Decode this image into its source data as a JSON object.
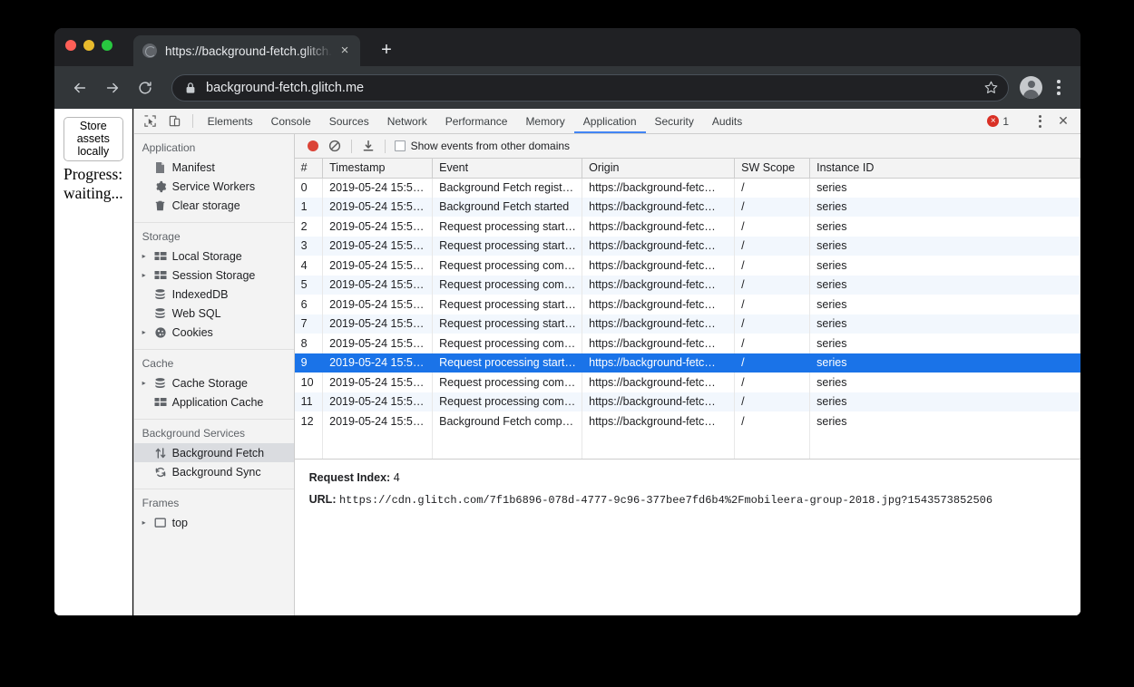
{
  "browser": {
    "tab": {
      "title": "https://background-fetch.glitch.me",
      "favicon": "globe-icon",
      "close": "×"
    },
    "new_tab": "+",
    "nav": {
      "back": "back-arrow-icon",
      "forward": "forward-arrow-icon",
      "reload": "reload-icon"
    },
    "omnibox": {
      "url": "background-fetch.glitch.me",
      "lock": "lock-icon",
      "star": "star-icon"
    },
    "profile": "avatar-icon",
    "menu": "kebab-menu-icon"
  },
  "page": {
    "store_assets_button": "Store assets locally",
    "progress": "Progress: waiting..."
  },
  "devtools": {
    "tabs": [
      {
        "label": "Elements",
        "selected": false
      },
      {
        "label": "Console",
        "selected": false
      },
      {
        "label": "Sources",
        "selected": false
      },
      {
        "label": "Network",
        "selected": false
      },
      {
        "label": "Performance",
        "selected": false
      },
      {
        "label": "Memory",
        "selected": false
      },
      {
        "label": "Application",
        "selected": true
      },
      {
        "label": "Security",
        "selected": false
      },
      {
        "label": "Audits",
        "selected": false
      }
    ],
    "error_count": "1",
    "close_label": "✕",
    "accent_color": "#4285f4",
    "selection_color": "#1a73e8",
    "error_color": "#d93025",
    "record_color": "#db4437",
    "sidebar": [
      {
        "header": "Application",
        "items": [
          {
            "label": "Manifest",
            "icon": "document-icon",
            "arrow": false,
            "selected": false
          },
          {
            "label": "Service Workers",
            "icon": "gear-icon",
            "arrow": false,
            "selected": false
          },
          {
            "label": "Clear storage",
            "icon": "trash-icon",
            "arrow": false,
            "selected": false
          }
        ]
      },
      {
        "header": "Storage",
        "items": [
          {
            "label": "Local Storage",
            "icon": "table-icon",
            "arrow": true,
            "selected": false
          },
          {
            "label": "Session Storage",
            "icon": "table-icon",
            "arrow": true,
            "selected": false
          },
          {
            "label": "IndexedDB",
            "icon": "database-icon",
            "arrow": false,
            "selected": false
          },
          {
            "label": "Web SQL",
            "icon": "database-icon",
            "arrow": false,
            "selected": false
          },
          {
            "label": "Cookies",
            "icon": "cookie-icon",
            "arrow": true,
            "selected": false
          }
        ]
      },
      {
        "header": "Cache",
        "items": [
          {
            "label": "Cache Storage",
            "icon": "database-icon",
            "arrow": true,
            "selected": false
          },
          {
            "label": "Application Cache",
            "icon": "table-icon",
            "arrow": false,
            "selected": false
          }
        ]
      },
      {
        "header": "Background Services",
        "items": [
          {
            "label": "Background Fetch",
            "icon": "updown-arrows-icon",
            "arrow": false,
            "selected": true
          },
          {
            "label": "Background Sync",
            "icon": "refresh-icon",
            "arrow": false,
            "selected": false
          }
        ]
      },
      {
        "header": "Frames",
        "items": [
          {
            "label": "top",
            "icon": "frame-icon",
            "arrow": true,
            "selected": false
          }
        ]
      }
    ],
    "toolbar": {
      "record": "record-button",
      "clear": "clear-button",
      "save": "save-button",
      "checkbox_checked": false,
      "checkbox_label": "Show events from other domains"
    },
    "table": {
      "columns": [
        "#",
        "Timestamp",
        "Event",
        "Origin",
        "SW Scope",
        "Instance ID"
      ],
      "rows": [
        {
          "idx": "0",
          "ts": "2019-05-24 15:5…",
          "event": "Background Fetch regist…",
          "origin": "https://background-fetc…",
          "sw": "/",
          "instance": "series",
          "selected": false
        },
        {
          "idx": "1",
          "ts": "2019-05-24 15:5…",
          "event": "Background Fetch started",
          "origin": "https://background-fetc…",
          "sw": "/",
          "instance": "series",
          "selected": false
        },
        {
          "idx": "2",
          "ts": "2019-05-24 15:5…",
          "event": "Request processing start…",
          "origin": "https://background-fetc…",
          "sw": "/",
          "instance": "series",
          "selected": false
        },
        {
          "idx": "3",
          "ts": "2019-05-24 15:5…",
          "event": "Request processing start…",
          "origin": "https://background-fetc…",
          "sw": "/",
          "instance": "series",
          "selected": false
        },
        {
          "idx": "4",
          "ts": "2019-05-24 15:5…",
          "event": "Request processing com…",
          "origin": "https://background-fetc…",
          "sw": "/",
          "instance": "series",
          "selected": false
        },
        {
          "idx": "5",
          "ts": "2019-05-24 15:5…",
          "event": "Request processing com…",
          "origin": "https://background-fetc…",
          "sw": "/",
          "instance": "series",
          "selected": false
        },
        {
          "idx": "6",
          "ts": "2019-05-24 15:5…",
          "event": "Request processing start…",
          "origin": "https://background-fetc…",
          "sw": "/",
          "instance": "series",
          "selected": false
        },
        {
          "idx": "7",
          "ts": "2019-05-24 15:5…",
          "event": "Request processing start…",
          "origin": "https://background-fetc…",
          "sw": "/",
          "instance": "series",
          "selected": false
        },
        {
          "idx": "8",
          "ts": "2019-05-24 15:5…",
          "event": "Request processing com…",
          "origin": "https://background-fetc…",
          "sw": "/",
          "instance": "series",
          "selected": false
        },
        {
          "idx": "9",
          "ts": "2019-05-24 15:5…",
          "event": "Request processing start…",
          "origin": "https://background-fetc…",
          "sw": "/",
          "instance": "series",
          "selected": true
        },
        {
          "idx": "10",
          "ts": "2019-05-24 15:5…",
          "event": "Request processing com…",
          "origin": "https://background-fetc…",
          "sw": "/",
          "instance": "series",
          "selected": false
        },
        {
          "idx": "11",
          "ts": "2019-05-24 15:5…",
          "event": "Request processing com…",
          "origin": "https://background-fetc…",
          "sw": "/",
          "instance": "series",
          "selected": false
        },
        {
          "idx": "12",
          "ts": "2019-05-24 15:5…",
          "event": "Background Fetch comp…",
          "origin": "https://background-fetc…",
          "sw": "/",
          "instance": "series",
          "selected": false
        }
      ]
    },
    "details": {
      "request_index_key": "Request Index:",
      "request_index_value": "4",
      "url_key": "URL:",
      "url_value": "https://cdn.glitch.com/7f1b6896-078d-4777-9c96-377bee7fd6b4%2Fmobileera-group-2018.jpg?1543573852506"
    }
  }
}
